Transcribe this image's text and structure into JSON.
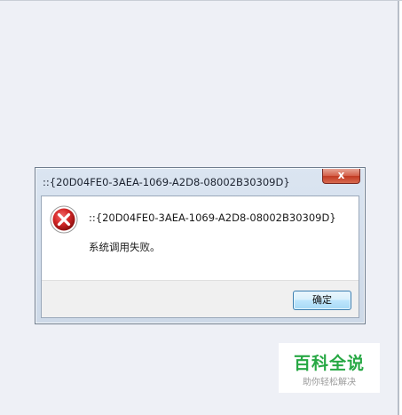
{
  "dialog": {
    "title": "::{20D04FE0-3AEA-1069-A2D8-08002B30309D}",
    "close_symbol": "x",
    "icon": "error-icon",
    "message": "::{20D04FE0-3AEA-1069-A2D8-08002B30309D}",
    "detail": "系统调用失败。",
    "ok_label": "确定"
  },
  "watermark": {
    "title": "百科全说",
    "subtitle": "助你轻松解决"
  },
  "colors": {
    "error_red": "#c62828",
    "watermark_green": "#27a844",
    "close_red": "#c13a22"
  }
}
